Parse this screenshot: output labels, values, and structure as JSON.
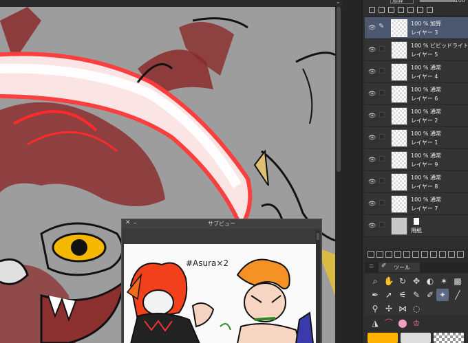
{
  "layer_panel": {
    "blend_mode": "加算",
    "opacity": "100",
    "layers": [
      {
        "mode": "100 % 加算",
        "name": "レイヤー 3",
        "selected": true
      },
      {
        "mode": "100 % ビビッドライト",
        "name": "レイヤー 5"
      },
      {
        "mode": "100 % 通常",
        "name": "レイヤー 4"
      },
      {
        "mode": "100 % 通常",
        "name": "レイヤー 6"
      },
      {
        "mode": "100 % 通常",
        "name": "レイヤー 2"
      },
      {
        "mode": "100 % 通常",
        "name": "レイヤー 1"
      },
      {
        "mode": "100 % 通常",
        "name": "レイヤー 9"
      },
      {
        "mode": "100 % 通常",
        "name": "レイヤー 8"
      },
      {
        "mode": "100 % 通常",
        "name": "レイヤー 7"
      }
    ],
    "paper_layer": {
      "name": "用紙"
    }
  },
  "tool_panel": {
    "tab_label": "ツール",
    "icons": [
      "zoom-icon",
      "hand-icon",
      "rotate-icon",
      "move-icon",
      "fill-icon",
      "sparkle-icon",
      "gradient-icon",
      "pen-icon",
      "selection-arrow-icon",
      "auto-select-icon",
      "brush-icon",
      "eraser-icon",
      "blend-icon",
      "line-icon",
      "eyedropper-icon",
      "decoration-icon",
      "figure-icon",
      "lasso-icon"
    ]
  },
  "colors": {
    "main": "#ffb300",
    "sub": "#dddddd",
    "transparent": "checker",
    "accent": "#5c6a86"
  },
  "subview": {
    "title": "サブビュー",
    "sketch_text": "#Asura×2"
  }
}
